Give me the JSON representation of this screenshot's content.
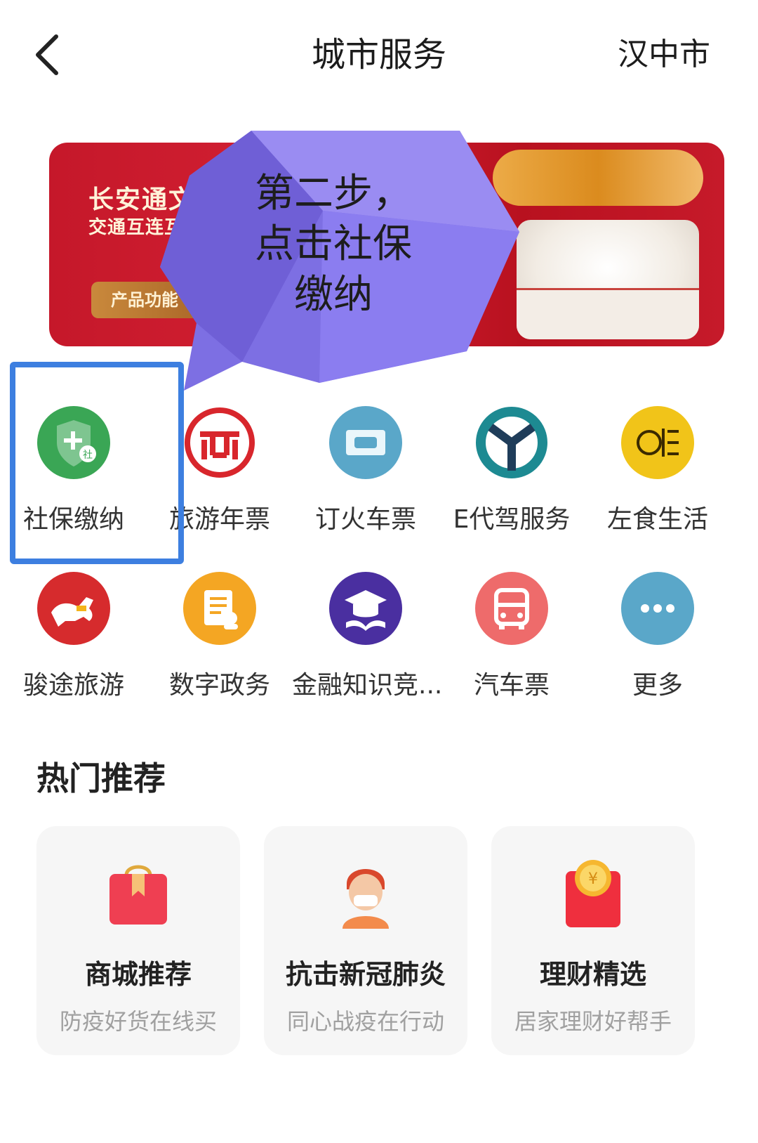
{
  "header": {
    "title": "城市服务",
    "city": "汉中市"
  },
  "banner": {
    "line1": "长安通文",
    "line2": "交通互连互",
    "button": "产品功能"
  },
  "callout": {
    "line1": "第二步，",
    "line2": "点击社保",
    "line3": "缴纳"
  },
  "services": [
    {
      "label": "社保缴纳",
      "icon": "shield-plus-icon",
      "color": "#3aa655"
    },
    {
      "label": "旅游年票",
      "icon": "travel-ticket-icon",
      "color": "#d8262c"
    },
    {
      "label": "订火车票",
      "icon": "train-ticket-icon",
      "color": "#5aa7c9"
    },
    {
      "label": "E代驾服务",
      "icon": "edaijia-logo-icon",
      "color": "#1d8a92"
    },
    {
      "label": "左食生活",
      "icon": "zuoshi-logo-icon",
      "color": "#f1c419"
    },
    {
      "label": "骏途旅游",
      "icon": "horse-icon",
      "color": "#d62b2d"
    },
    {
      "label": "数字政务",
      "icon": "document-person-icon",
      "color": "#f4a623"
    },
    {
      "label": "金融知识竞...",
      "icon": "graduation-cap-icon",
      "color": "#4a2fa0"
    },
    {
      "label": "汽车票",
      "icon": "bus-icon",
      "color": "#ee6b6b"
    },
    {
      "label": "更多",
      "icon": "more-dots-icon",
      "color": "#5aa7c9"
    }
  ],
  "recommend": {
    "title": "热门推荐",
    "cards": [
      {
        "title": "商城推荐",
        "subtitle": "防疫好货在线买",
        "icon": "shopping-bag-icon"
      },
      {
        "title": "抗击新冠肺炎",
        "subtitle": "同心战疫在行动",
        "icon": "person-mask-icon"
      },
      {
        "title": "理财精选",
        "subtitle": "居家理财好帮手",
        "icon": "red-envelope-icon"
      }
    ]
  }
}
